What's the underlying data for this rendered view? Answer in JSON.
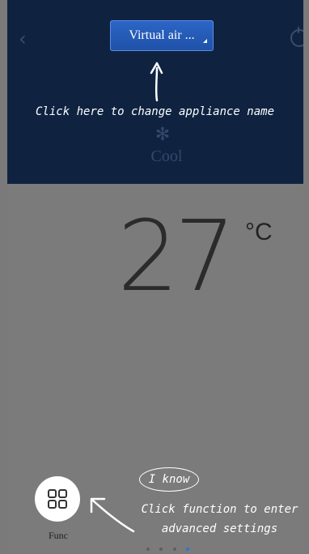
{
  "header": {
    "appliance_name": "Virtual air ...",
    "back_icon": "chevron-left-icon",
    "power_icon": "power-icon"
  },
  "mode": {
    "icon": "snowflake-icon",
    "label": "Cool"
  },
  "temperature": {
    "value": "27",
    "unit": "°C"
  },
  "func": {
    "label": "Func",
    "icon": "grid-icon"
  },
  "guide": {
    "name_hint": "Click here to change appliance name",
    "dismiss": "I know",
    "func_hint_line1": "Click function to enter",
    "func_hint_line2": "advanced settings"
  },
  "pager": {
    "count": 4,
    "active_index": 3
  },
  "colors": {
    "header_bg": "#0f2341",
    "accent": "#2d66c7",
    "overlay_bg": "#7b7b7b"
  }
}
